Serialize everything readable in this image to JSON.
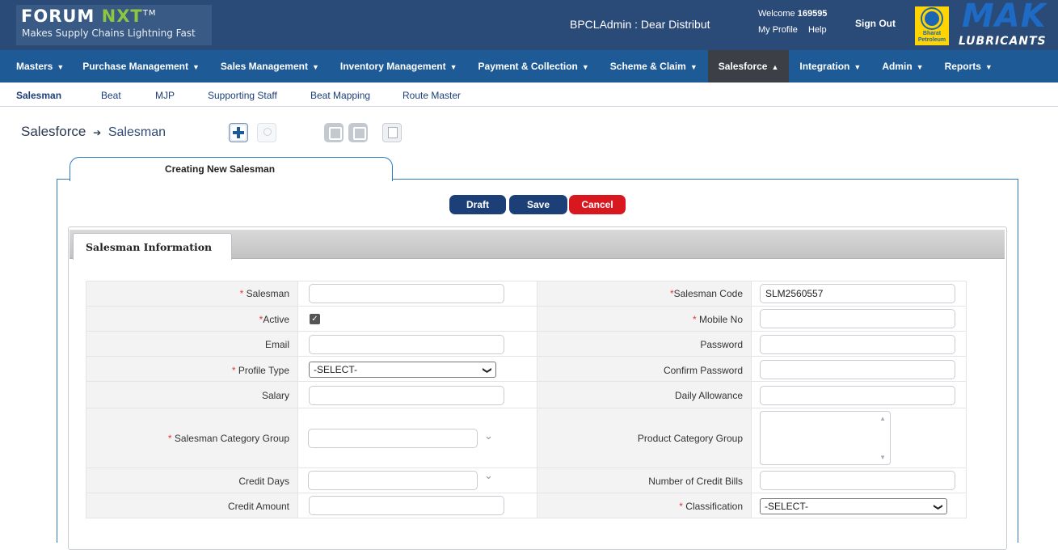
{
  "header": {
    "brand_forum": "FORUM",
    "brand_nxt": "NXT",
    "brand_tm": "TM",
    "tagline": "Makes Supply Chains Lightning Fast",
    "distributor": "BPCLAdmin : Dear Distribut",
    "welcome_label": "Welcome",
    "user_id": "169595",
    "my_profile": "My Profile",
    "help": "Help",
    "sign_out": "Sign Out",
    "partner_logo_text": "Bharat Petroleum",
    "mak_big": "MAK",
    "mak_small": "LUBRICANTS"
  },
  "nav": {
    "items": [
      {
        "label": "Masters",
        "caret": "▼"
      },
      {
        "label": "Purchase Management",
        "caret": "▼"
      },
      {
        "label": "Sales Management",
        "caret": "▼"
      },
      {
        "label": "Inventory Management",
        "caret": "▼"
      },
      {
        "label": "Payment & Collection",
        "caret": "▼"
      },
      {
        "label": "Scheme & Claim",
        "caret": "▼"
      },
      {
        "label": "Salesforce",
        "caret": "▲"
      },
      {
        "label": "Integration",
        "caret": "▼"
      },
      {
        "label": "Admin",
        "caret": "▼"
      },
      {
        "label": "Reports",
        "caret": "▼"
      }
    ]
  },
  "subnav": {
    "items": [
      "Salesman",
      "Beat",
      "MJP",
      "Supporting Staff",
      "Beat Mapping",
      "Route Master"
    ]
  },
  "page": {
    "title": "Salesforce",
    "arrow": "➔",
    "crumb": "Salesman"
  },
  "form": {
    "tab_title": "Creating New Salesman",
    "draft": "Draft",
    "save": "Save",
    "cancel": "Cancel",
    "section_title": "Salesman Information",
    "required_mark": "*",
    "fields": {
      "salesman": "Salesman",
      "salesman_code": "Salesman Code",
      "salesman_code_value": "SLM2560557",
      "active": "Active",
      "mobile_no": "Mobile No",
      "email": "Email",
      "password": "Password",
      "profile_type": "Profile Type",
      "profile_type_value": "-SELECT-",
      "confirm_password": "Confirm Password",
      "salary": "Salary",
      "daily_allowance": "Daily Allowance",
      "salesman_category_group": "Salesman Category Group",
      "product_category_group": "Product Category Group",
      "credit_days": "Credit Days",
      "number_of_credit_bills": "Number of Credit Bills",
      "credit_amount": "Credit Amount",
      "classification": "Classification",
      "classification_value": "-SELECT-"
    }
  },
  "colors": {
    "header_bg": "#2a4a78",
    "nav_bg": "#1d5a96",
    "nav_active": "#3c3f46",
    "button_primary": "#1d3f78",
    "button_cancel": "#d9171e",
    "required": "#e53935"
  },
  "icons": [
    "add-icon",
    "search-icon",
    "download-icon",
    "upload-icon",
    "copy-icon",
    "checkbox-checked-icon",
    "chevron-down-icon"
  ]
}
